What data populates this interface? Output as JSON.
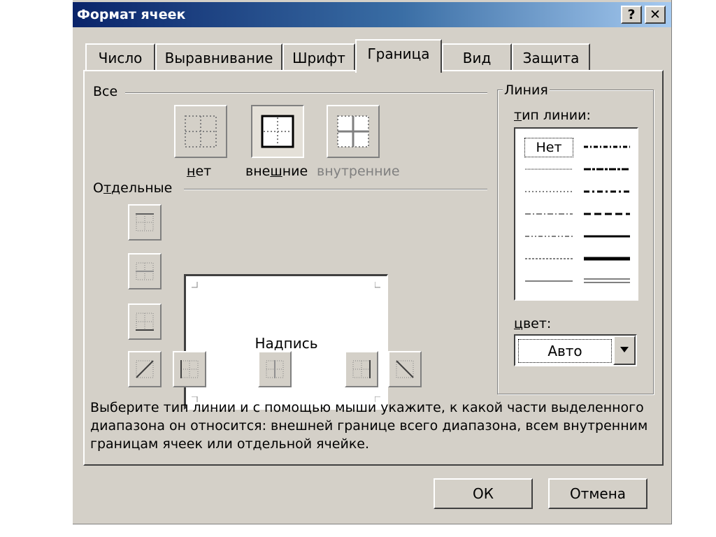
{
  "window": {
    "title": "Формат ячеек",
    "help_glyph": "?",
    "close_glyph": "✕"
  },
  "tabs": [
    {
      "label": "Число",
      "active": false
    },
    {
      "label": "Выравнивание",
      "active": false
    },
    {
      "label": "Шрифт",
      "active": false
    },
    {
      "label": "Граница",
      "active": true
    },
    {
      "label": "Вид",
      "active": false
    },
    {
      "label": "Защита",
      "active": false
    }
  ],
  "presets": {
    "group_label": "Все",
    "none_label_pre": "",
    "none_label_ul": "н",
    "none_label_post": "ет",
    "outline_label_pre": "вне",
    "outline_label_ul": "ш",
    "outline_label_post": "ние",
    "inside_label": "внутренние",
    "inside_enabled": false
  },
  "individual": {
    "group_label_pre": "О",
    "group_label_ul": "т",
    "group_label_post": "дельные",
    "preview_text": "Надпись"
  },
  "line": {
    "group_label": "Линия",
    "style_label_ul": "т",
    "style_label_post": "ип линии:",
    "none_style_label": "Нет",
    "color_label_ul": "ц",
    "color_label_post": "вет:",
    "color_value": "Авто"
  },
  "hint_text": "Выберите тип линии и с помощью мыши укажите, к какой части выделенного диапазона он относится: внешней границе всего диапазона, всем внутренним границам ячеек или отдельной ячейке.",
  "buttons": {
    "ok": "ОК",
    "cancel": "Отмена"
  },
  "colors": {
    "dialog_bg": "#d4d0c8",
    "title_start": "#0a246a",
    "title_end": "#a6caf0",
    "disabled_text": "#808080"
  }
}
